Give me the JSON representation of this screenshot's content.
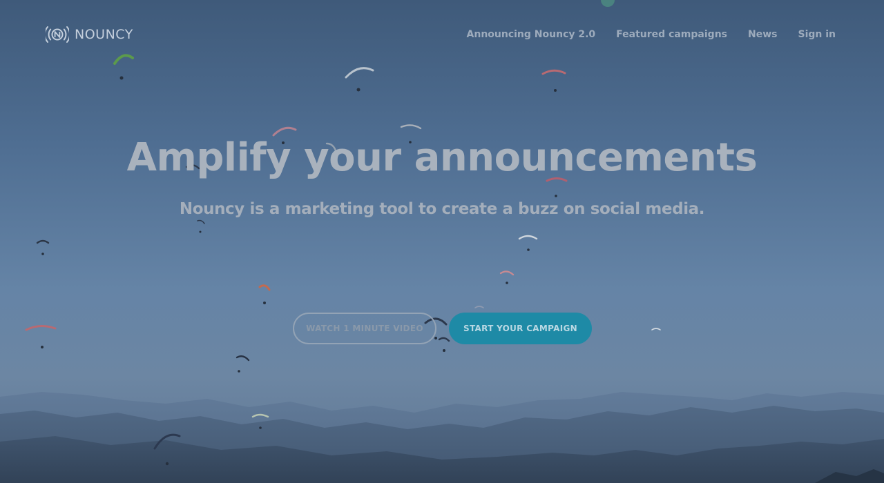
{
  "brand": {
    "name": "NOUNCY",
    "logo_icon": "signal-n-icon"
  },
  "nav": {
    "items": [
      {
        "label": "Announcing Nouncy 2.0"
      },
      {
        "label": "Featured campaigns"
      },
      {
        "label": "News"
      },
      {
        "label": "Sign in"
      }
    ]
  },
  "hero": {
    "headline": "Amplify your announcements",
    "subheadline": "Nouncy is a marketing tool to create a buzz on social media.",
    "secondary_cta": "WATCH 1 MINUTE VIDEO",
    "primary_cta": "START YOUR CAMPAIGN",
    "background": "sky-with-paragliders-and-mountains"
  },
  "colors": {
    "accent": "#1e8aa6",
    "overlay": "#3f5a7a"
  }
}
